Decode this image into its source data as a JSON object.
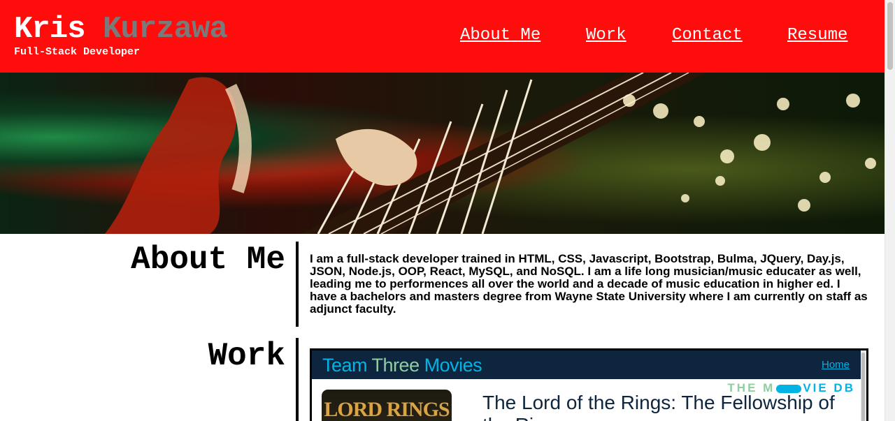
{
  "header": {
    "first_name": "Kris",
    "last_name": "Kurzawa",
    "tagline": "Full-Stack Developer",
    "nav": [
      {
        "label": "About Me"
      },
      {
        "label": "Work"
      },
      {
        "label": "Contact"
      },
      {
        "label": "Resume"
      }
    ]
  },
  "hero": {
    "icon": "guitar-photo"
  },
  "about": {
    "title": "About Me",
    "text": "I am a full-stack developer trained in HTML, CSS, Javascript, Bootstrap, Bulma, JQuery, Day.js, JSON, Node.js, OOP, React, MySQL, and NoSQL. I am a life long musician/music educater as well, leading me to performences all over the world and a decade of music education in higher ed. I have a bachelors and masters degree from Wayne State University where I am currently on staff as adjunct faculty."
  },
  "work": {
    "title": "Work",
    "project": {
      "brand_part1": "Team ",
      "brand_part2": "Three",
      "brand_part3": " Movies",
      "home_link": "Home",
      "logo_left": "THE M",
      "logo_right": "VIE DB",
      "poster_text": "LORD RINGS",
      "movie_title": "The Lord of the Rings: The Fellowship of the Ring"
    }
  },
  "colors": {
    "header_bg": "#ff0d0d",
    "last_name": "#7a7a7a",
    "card_bar": "#0d253f",
    "accent_blue": "#01b4e4",
    "accent_green": "#90cea1"
  }
}
